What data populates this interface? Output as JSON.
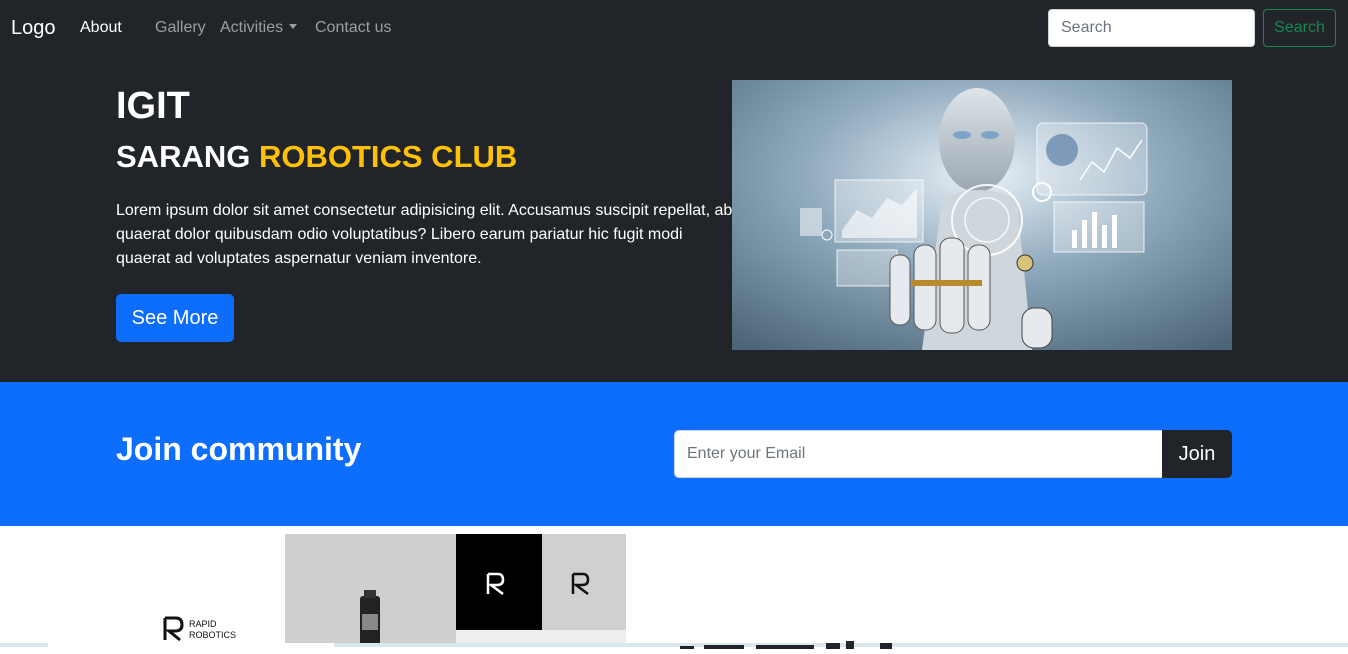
{
  "navbar": {
    "brand": "Logo",
    "links": [
      "About",
      "Gallery",
      "Activities",
      "Contact us"
    ],
    "search_placeholder": "Search",
    "search_button": "Search"
  },
  "hero": {
    "title": "IGIT",
    "subtitle_white": "SARANG ",
    "subtitle_accent": "ROBOTICS CLUB",
    "text": "Lorem ipsum dolor sit amet consectetur adipisicing elit. Accusamus suscipit repellat, ab quaerat dolor quibusdam odio voluptatibus? Libero earum pariatur hic fugit modi quaerat ad voluptates aspernatur veniam inventore.",
    "button": "See More"
  },
  "join": {
    "title": "Join community",
    "email_placeholder": "Enter your Email",
    "button": "Join"
  },
  "lower": {
    "logo_line1": "RAPID",
    "logo_line2": "ROBOTICS"
  },
  "colors": {
    "dark": "#212529",
    "primary": "#0d6efd",
    "accent": "#ffc107",
    "success": "#198754"
  }
}
